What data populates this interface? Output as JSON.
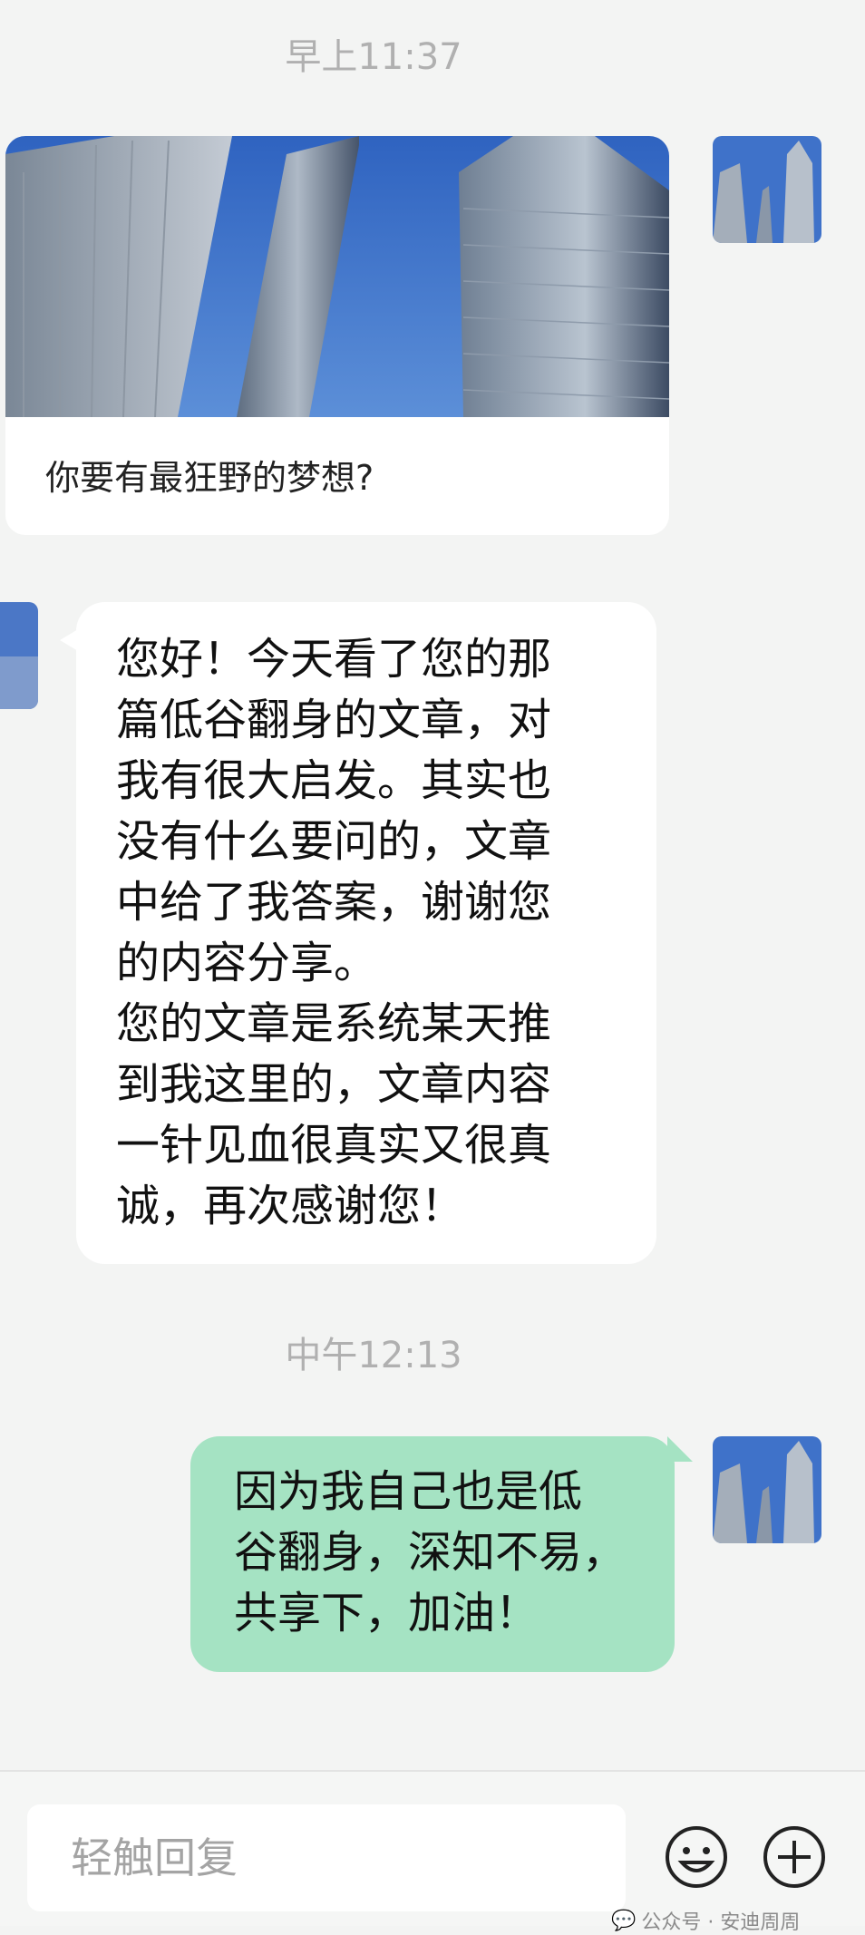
{
  "timestamps": [
    "早上11:37",
    "中午12:13"
  ],
  "shared_card": {
    "caption": "你要有最狂野的梦想?"
  },
  "incoming_message": {
    "text": "您好！今天看了您的那\n篇低谷翻身的文章，对\n我有很大启发。其实也\n没有什么要问的，文章\n中给了我答案，谢谢您\n的内容分享。\n您的文章是系统某天推\n到我这里的，文章内容\n一针见血很真实又很真\n诚，再次感谢您！"
  },
  "outgoing_message": {
    "text": "因为我自己也是低\n谷翻身，深知不易，\n共享下，加油！"
  },
  "input_bar": {
    "placeholder": "轻触回复"
  },
  "icons": [
    "emoji-icon",
    "plus-icon"
  ],
  "watermark": "公众号 · 安迪周周",
  "colors": {
    "background": "#f3f4f3",
    "outgoing_bubble": "#a5e3c3",
    "incoming_bubble": "#ffffff",
    "sky": "#3a6fc4"
  }
}
